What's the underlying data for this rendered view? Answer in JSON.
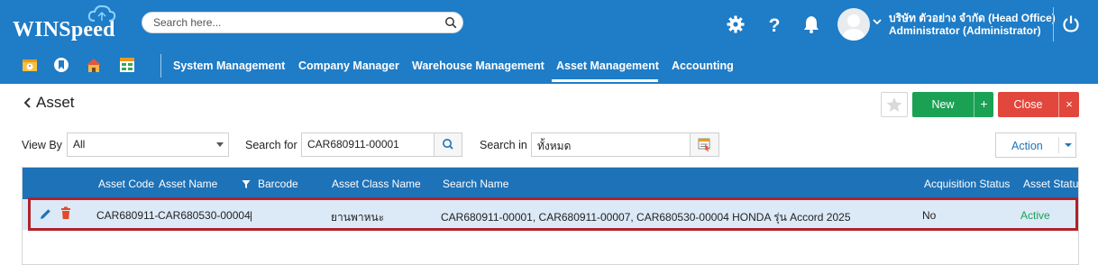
{
  "app": {
    "logo_text": "WINSpeed",
    "search_placeholder": "Search here...",
    "user": {
      "company": "บริษัท ตัวอย่าง จำกัด (Head Office)",
      "role": "Administrator (Administrator)"
    }
  },
  "nav": {
    "items": [
      "System Management",
      "Company Manager",
      "Warehouse Management",
      "Asset Management",
      "Accounting"
    ],
    "active": "Asset Management"
  },
  "page": {
    "title": "Asset",
    "new_label": "New",
    "new_plus": "+",
    "close_label": "Close",
    "close_x": "×",
    "action_label": "Action"
  },
  "filters": {
    "view_by_label": "View By",
    "view_by_value": "All",
    "search_for_label": "Search for",
    "search_for_value": "CAR680911-00001",
    "search_in_label": "Search in",
    "search_in_value": "ทั้งหมด"
  },
  "grid": {
    "columns": [
      "Asset Code",
      "Asset Name",
      "Barcode",
      "Asset Class Name",
      "Search Name",
      "Acquisition Status",
      "Asset Status"
    ],
    "rows": [
      {
        "asset_code": "CAR680911-",
        "asset_name": "CAR680530-00004",
        "barcode": "|",
        "asset_class_name": "ยานพาหนะ",
        "search_name": "CAR680911-00001, CAR680911-00007, CAR680530-00004  HONDA รุ่น Accord 2025",
        "acquisition_status": "No",
        "asset_status": "Active"
      }
    ]
  },
  "colors": {
    "header_blue": "#1f7cc6",
    "grid_header": "#1e72b8",
    "new_green": "#1aa154",
    "close_red": "#e1473d",
    "highlight": "#b0212a"
  }
}
